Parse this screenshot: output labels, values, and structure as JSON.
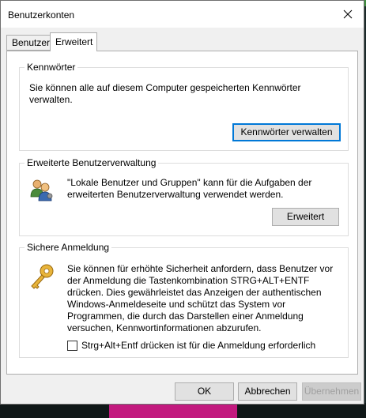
{
  "window": {
    "title": "Benutzerkonten"
  },
  "tabs": [
    {
      "label": "Benutzer"
    },
    {
      "label": "Erweitert"
    }
  ],
  "passwords": {
    "group_label": "Kennwörter",
    "description": "Sie können alle auf diesem Computer gespeicherten Kennwörter verwalten.",
    "button_label": "Kennwörter verwalten"
  },
  "advanced": {
    "group_label": "Erweiterte Benutzerverwaltung",
    "description": "\"Lokale Benutzer und Gruppen\" kann für die Aufgaben der erweiterten Benutzerverwaltung verwendet werden.",
    "button_label": "Erweitert"
  },
  "secure_login": {
    "group_label": "Sichere Anmeldung",
    "description": "Sie können für erhöhte Sicherheit anfordern, dass Benutzer vor der Anmeldung die Tastenkombination STRG+ALT+ENTF drücken. Dies gewährleistet das Anzeigen der authentischen Windows-Anmeldeseite und schützt das System vor Programmen, die durch das Darstellen einer Anmeldung versuchen, Kennwortinformationen abzurufen.",
    "checkbox_label": "Strg+Alt+Entf drücken ist für die Anmeldung erforderlich",
    "checkbox_checked": false
  },
  "footer": {
    "ok_label": "OK",
    "cancel_label": "Abbrechen",
    "apply_label": "Übernehmen"
  }
}
